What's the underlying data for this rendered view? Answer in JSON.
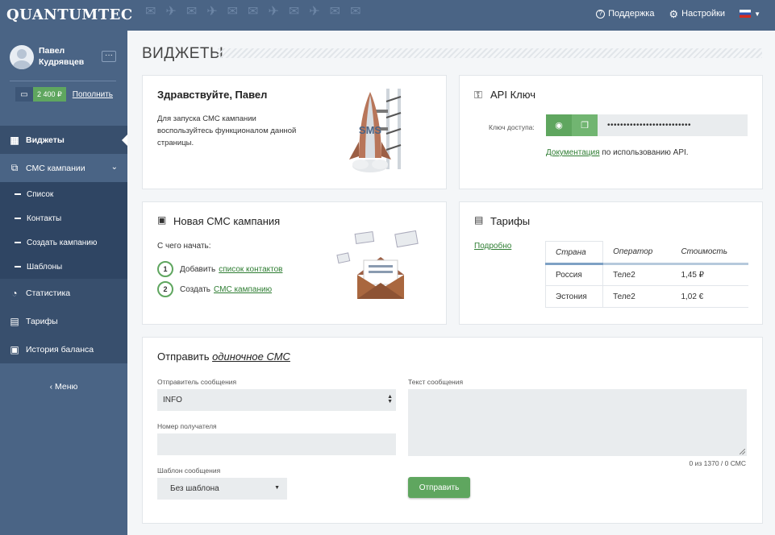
{
  "brand": {
    "logo": "QUANTUMTEC"
  },
  "topnav": {
    "support": "Поддержка",
    "settings": "Настройки"
  },
  "user": {
    "first_name": "Павел",
    "last_name": "Кудрявцев",
    "balance": "2 400 ₽",
    "topup": "Пополнить"
  },
  "sidebar": {
    "items": [
      {
        "label": "Виджеты",
        "icon": "widgets-icon"
      },
      {
        "label": "СМС кампании",
        "icon": "sms-campaign-icon"
      }
    ],
    "subitems": [
      "Список",
      "Контакты",
      "Создать кампанию",
      "Шаблоны"
    ],
    "items2": [
      {
        "label": "Статистика",
        "icon": "pie-chart-icon"
      },
      {
        "label": "Тарифы",
        "icon": "tariffs-icon"
      },
      {
        "label": "История баланса",
        "icon": "balance-history-icon"
      }
    ],
    "back": "Меню"
  },
  "page": {
    "title": "ВИДЖЕТЫ"
  },
  "hello": {
    "title": "Здравствуйте, Павел",
    "text": "Для запуска СМС кампании воспользуйтесь функционалом данной страницы.",
    "rocket_text": "SMS"
  },
  "api": {
    "title": "API Ключ",
    "key_label": "Ключ доступа:",
    "key_value": "••••••••••••••••••••••••••",
    "doc_link": "Документация",
    "doc_rest": " по использованию API."
  },
  "campaign": {
    "title": "Новая СМС кампания",
    "start": "С чего начать:",
    "steps": [
      {
        "num": "1",
        "text": "Добавить",
        "link": "список контактов"
      },
      {
        "num": "2",
        "text": "Создать",
        "link": "СМС кампанию"
      }
    ]
  },
  "tariffs": {
    "title": "Тарифы",
    "more": "Подробно",
    "headers": [
      "Страна",
      "Оператор",
      "Стоимость"
    ],
    "rows": [
      [
        "Россия",
        "Теле2",
        "1,45 ₽"
      ],
      [
        "Эстония",
        "Теле2",
        "1,02 €"
      ]
    ]
  },
  "send": {
    "title_pre": "Отправить ",
    "title_link": "одиночное СМС",
    "sender_label": "Отправитель сообщения",
    "sender_value": "INFO",
    "recipient_label": "Номер получателя",
    "recipient_value": "",
    "template_label": "Шаблон сообщения",
    "template_value": "Без шаблона",
    "message_label": "Текст сообщения",
    "message_value": "",
    "counter": "0 из 1370 / 0 СМС",
    "button": "Отправить"
  },
  "colors": {
    "accent": "#5fa65f",
    "sidebar": "#4a6485",
    "sidebar_active": "#384f6d",
    "link": "#2e7d32"
  }
}
